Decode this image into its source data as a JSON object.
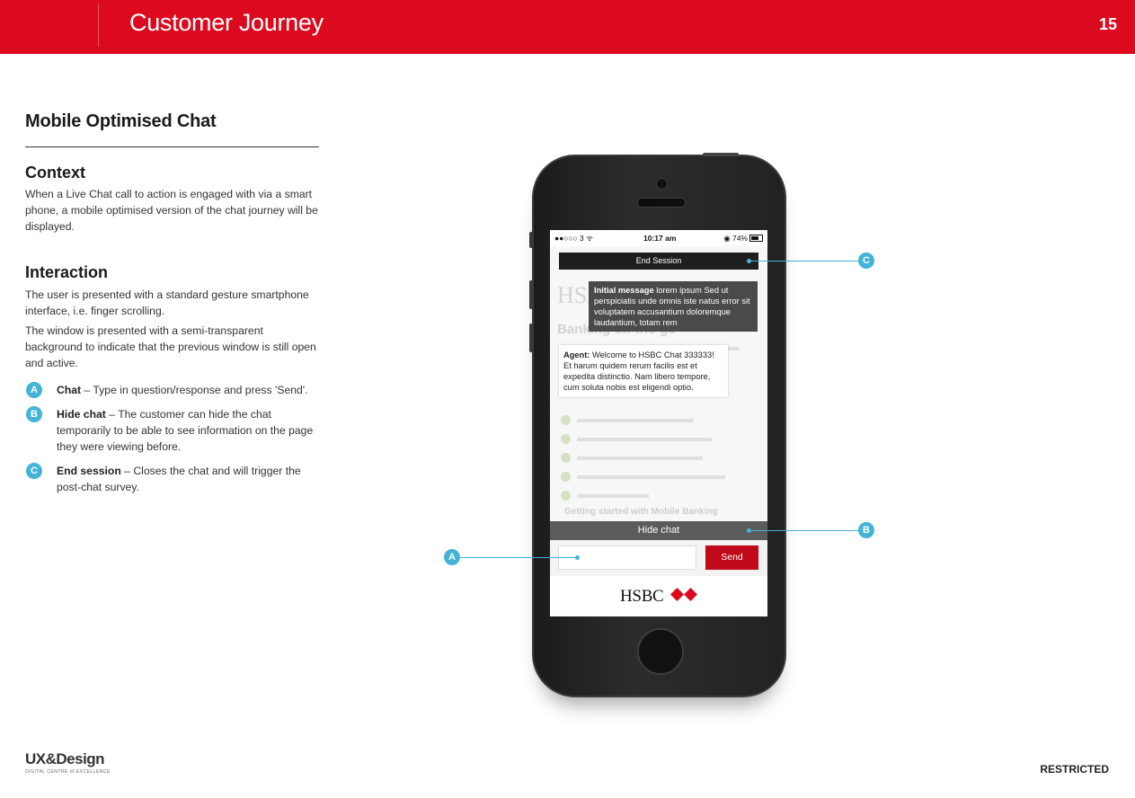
{
  "header": {
    "title": "Customer Journey",
    "page_number": "15"
  },
  "left": {
    "section_title": "Mobile Optimised Chat",
    "context": {
      "heading": "Context",
      "body": "When a Live Chat call to action is engaged with via a smart phone, a mobile optimised version of the chat journey will be displayed."
    },
    "interaction": {
      "heading": "Interaction",
      "p1": "The user is presented with a standard gesture smartphone interface, i.e. finger scrolling.",
      "p2": "The window is presented with a semi-transparent background to indicate that the previous window is still open and active."
    },
    "legend": [
      {
        "marker": "A",
        "term": "Chat",
        "desc": " – Type in question/response and press 'Send'."
      },
      {
        "marker": "B",
        "term": "Hide chat",
        "desc": " – The customer can hide the chat temporarily to be able to see information on the page they were viewing before."
      },
      {
        "marker": "C",
        "term": "End session",
        "desc": " – Closes the chat and will trigger the post-chat survey."
      }
    ]
  },
  "phone": {
    "status": {
      "carrier": "●●○○○ 3 ᯤ",
      "time": "10:17 am",
      "battery": "◉ 74%"
    },
    "bg": {
      "brand": "HSBC",
      "heading": "Banking on-the-go",
      "subheading": "Getting started with Mobile Banking"
    },
    "end_session": "End Session",
    "initial_message": {
      "label": "Initial message",
      "text": " lorem ipsum Sed ut perspiciatis unde omnis iste natus error sit voluptatem accusantium doloremque laudantium, totam rem"
    },
    "agent_message": {
      "label": "Agent:",
      "text": " Welcome to HSBC Chat 333333! Et harum quidem rerum facilis est et expedita distinctio. Nam libero tempore, cum soluta nobis est eligendi optio."
    },
    "hide_chat": "Hide chat",
    "send": "Send",
    "logo_text": "HSBC"
  },
  "callouts": {
    "a": "A",
    "b": "B",
    "c": "C"
  },
  "footer": {
    "logo_main": "UX&Design",
    "logo_sub": "DIGITAL CENTRE of EXCELLENCE",
    "restricted": "RESTRICTED"
  },
  "colors": {
    "brand_red": "#db0a1e",
    "callout_blue": "#43b3d8",
    "send_red": "#c0091a"
  }
}
